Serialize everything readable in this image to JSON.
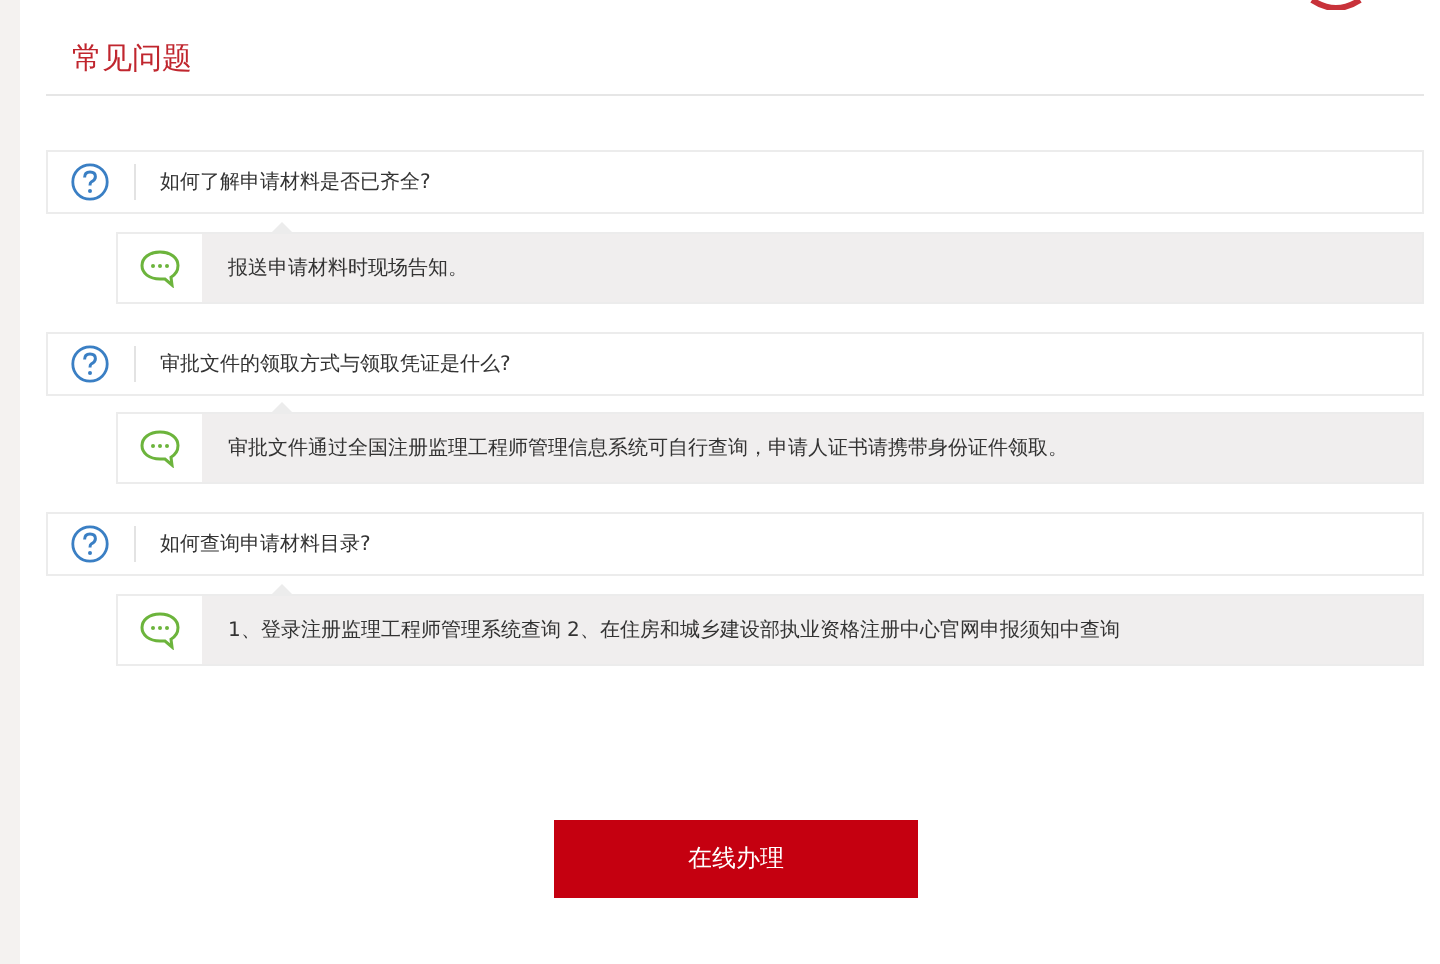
{
  "section_title": "常见问题",
  "faq": [
    {
      "question": "如何了解申请材料是否已齐全?",
      "answer": "报送申请材料时现场告知。"
    },
    {
      "question": "审批文件的领取方式与领取凭证是什么?",
      "answer": "审批文件通过全国注册监理工程师管理信息系统可自行查询，申请人证书请携带身份证件领取。"
    },
    {
      "question": "如何查询申请材料目录?",
      "answer": "1、登录注册监理工程师管理系统查询 2、在住房和城乡建设部执业资格注册中心官网申报须知中查询"
    }
  ],
  "action_button": "在线办理"
}
